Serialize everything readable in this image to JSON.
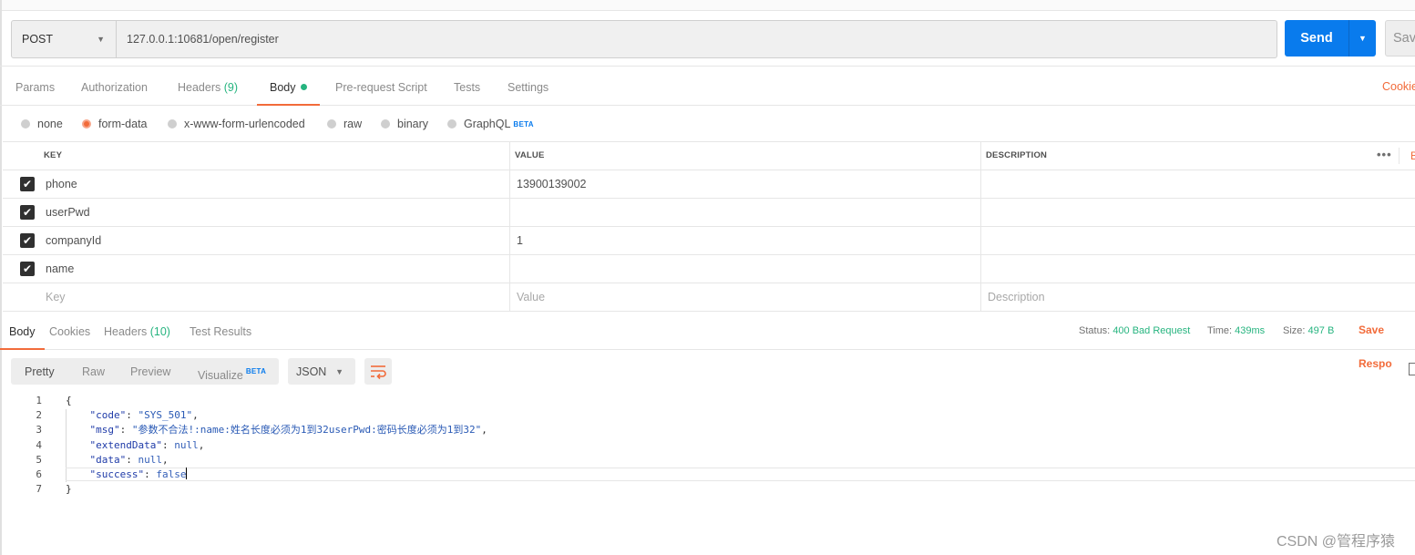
{
  "request": {
    "method": "POST",
    "url": "127.0.0.1:10681/open/register",
    "send_label": "Send",
    "save_label": "Sav"
  },
  "request_tabs": [
    {
      "label": "Params",
      "count": ""
    },
    {
      "label": "Authorization",
      "count": ""
    },
    {
      "label": "Headers",
      "count": "(9)"
    },
    {
      "label": "Body",
      "count": "",
      "active": true
    },
    {
      "label": "Pre-request Script",
      "count": ""
    },
    {
      "label": "Tests",
      "count": ""
    },
    {
      "label": "Settings",
      "count": ""
    }
  ],
  "cookies_link": "Cookie",
  "body_types": [
    {
      "label": "none"
    },
    {
      "label": "form-data",
      "selected": true
    },
    {
      "label": "x-www-form-urlencoded"
    },
    {
      "label": "raw"
    },
    {
      "label": "binary"
    },
    {
      "label": "GraphQL",
      "badge": "BETA"
    }
  ],
  "table": {
    "headers": {
      "key": "KEY",
      "value": "VALUE",
      "description": "DESCRIPTION"
    },
    "more": "•••",
    "bulk": "B",
    "rows": [
      {
        "key": "phone",
        "value": "13900139002",
        "description": ""
      },
      {
        "key": "userPwd",
        "value": "",
        "description": ""
      },
      {
        "key": "companyId",
        "value": "1",
        "description": ""
      },
      {
        "key": "name",
        "value": "",
        "description": ""
      }
    ],
    "placeholders": {
      "key": "Key",
      "value": "Value",
      "description": "Description"
    }
  },
  "response_tabs": [
    {
      "label": "Body",
      "count": "",
      "active": true
    },
    {
      "label": "Cookies",
      "count": ""
    },
    {
      "label": "Headers",
      "count": "(10)"
    },
    {
      "label": "Test Results",
      "count": ""
    }
  ],
  "status": {
    "status_label": "Status:",
    "status_value": "400 Bad Request",
    "time_label": "Time:",
    "time_value": "439ms",
    "size_label": "Size:",
    "size_value": "497 B",
    "save_response": "Save Respo"
  },
  "view_modes": [
    {
      "label": "Pretty",
      "active": true
    },
    {
      "label": "Raw"
    },
    {
      "label": "Preview"
    },
    {
      "label": "Visualize",
      "badge": "BETA"
    }
  ],
  "format": "JSON",
  "icons": {
    "wrap": "wrap-lines-icon",
    "dropdown": "chevron-down-icon",
    "checkbox": "check-icon"
  },
  "colors": {
    "accent": "#f26b3a",
    "send": "#097bed",
    "success": "#26b47f"
  },
  "code_lines": [
    {
      "n": "1",
      "indent": "",
      "key": "",
      "sep": "",
      "val": "{",
      "trail": ""
    },
    {
      "n": "2",
      "indent": "    ",
      "key": "\"code\"",
      "sep": ": ",
      "val": "\"SYS_501\"",
      "trail": ","
    },
    {
      "n": "3",
      "indent": "    ",
      "key": "\"msg\"",
      "sep": ": ",
      "val": "\"参数不合法!:name:姓名长度必须为1到32userPwd:密码长度必须为1到32\"",
      "trail": ","
    },
    {
      "n": "4",
      "indent": "    ",
      "key": "\"extendData\"",
      "sep": ": ",
      "val": "null",
      "trail": ","
    },
    {
      "n": "5",
      "indent": "    ",
      "key": "\"data\"",
      "sep": ": ",
      "val": "null",
      "trail": ","
    },
    {
      "n": "6",
      "indent": "    ",
      "key": "\"success\"",
      "sep": ": ",
      "val": "false",
      "trail": ""
    },
    {
      "n": "7",
      "indent": "",
      "key": "",
      "sep": "",
      "val": "}",
      "trail": ""
    }
  ],
  "watermark": "CSDN @管程序猿"
}
